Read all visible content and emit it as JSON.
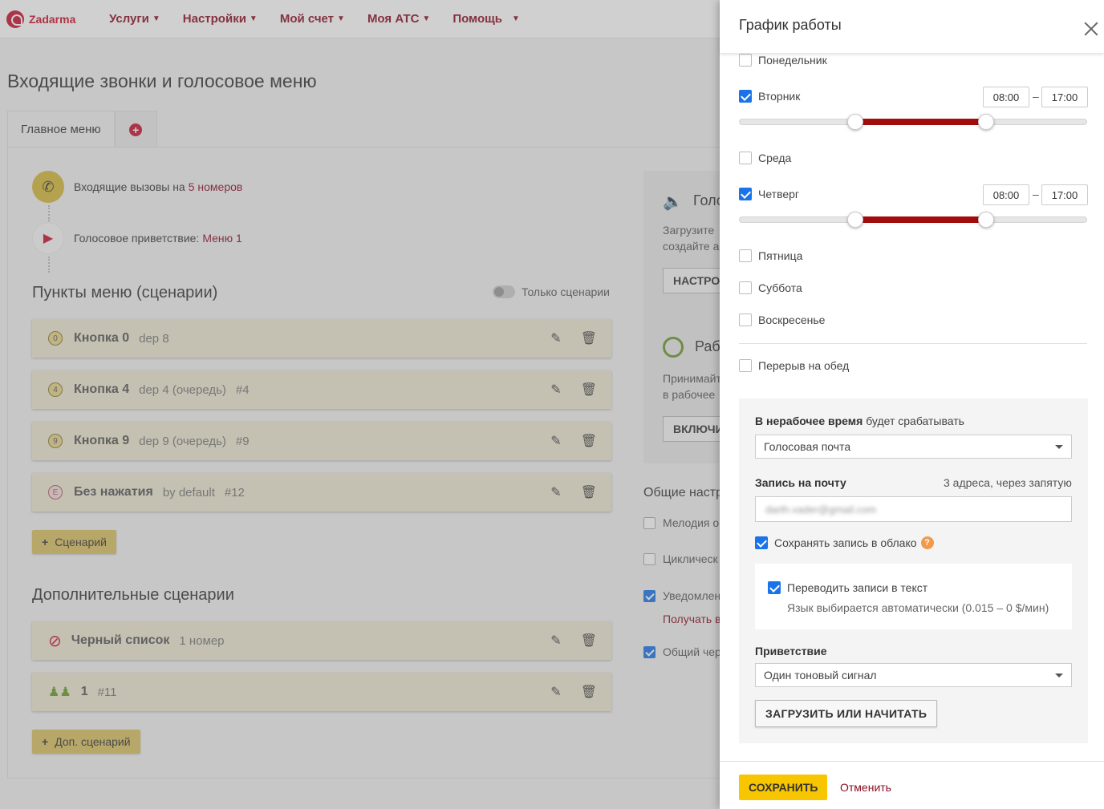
{
  "app": {
    "logo_text": "Zadarma"
  },
  "nav": {
    "items": [
      {
        "label": "Услуги"
      },
      {
        "label": "Настройки"
      },
      {
        "label": "Мой счет"
      },
      {
        "label": "Моя АТС"
      },
      {
        "label": "Помощь"
      }
    ]
  },
  "page": {
    "title": "Входящие звонки и голосовое меню",
    "tabs": [
      {
        "label": "Главное меню"
      },
      {
        "label": "+"
      }
    ]
  },
  "flow": {
    "incoming_prefix": "Входящие вызовы на",
    "incoming_link": "5 номеров",
    "greeting_prefix": "Голосовое приветствие:",
    "greeting_link": "Меню 1"
  },
  "menu_section": {
    "title": "Пункты меню (сценарии)",
    "toggle_label": "Только сценарии",
    "items": [
      {
        "key": "0",
        "name": "Кнопка 0",
        "sub": "dep 8",
        "extra": ""
      },
      {
        "key": "4",
        "name": "Кнопка 4",
        "sub": "dep 4 (очередь)",
        "extra": "#4"
      },
      {
        "key": "9",
        "name": "Кнопка 9",
        "sub": "dep 9 (очередь)",
        "extra": "#9"
      },
      {
        "key": "E",
        "name": "Без нажатия",
        "sub": "by default",
        "extra": "#12"
      }
    ],
    "add_button": "Сценарий"
  },
  "extra_section": {
    "title": "Дополнительные сценарии",
    "items": [
      {
        "name": "Черный список",
        "sub": "1 номер"
      },
      {
        "name": "1",
        "sub": "#11"
      }
    ],
    "add_button": "Доп. сценарий"
  },
  "right_column": {
    "voice_title": "Голо",
    "voice_text_1": "Загрузите",
    "voice_text_2": "создайте а",
    "voice_button": "НАСТРО",
    "work_title": "Раб",
    "work_text_1": "Принимайт",
    "work_text_2": "в рабочее",
    "work_button": "ВКЛЮЧИ",
    "general_title": "Общие настр",
    "opts": [
      {
        "label": "Мелодия о",
        "checked": false
      },
      {
        "label": "Циклическ",
        "checked": false
      },
      {
        "label": "Уведомлен",
        "checked": true
      },
      {
        "label": "Общий чер",
        "checked": true
      }
    ],
    "notify_link": "Получать в"
  },
  "drawer": {
    "title": "График работы",
    "days": [
      {
        "label": "Понедельник",
        "checked": false
      },
      {
        "label": "Вторник",
        "checked": true,
        "from": "08:00",
        "to": "17:00"
      },
      {
        "label": "Среда",
        "checked": false
      },
      {
        "label": "Четверг",
        "checked": true,
        "from": "08:00",
        "to": "17:00"
      },
      {
        "label": "Пятница",
        "checked": false
      },
      {
        "label": "Суббота",
        "checked": false
      },
      {
        "label": "Воскресенье",
        "checked": false
      }
    ],
    "time_separator": "–",
    "lunch": "Перерыв на обед",
    "offhours": {
      "label_bold": "В нерабочее время",
      "label_rest": "будет срабатывать",
      "select_value": "Голосовая почта",
      "email_label": "Запись на почту",
      "email_hint": "3 адреса, через запятую",
      "email_value": "darth.vader@gmail.com",
      "cloud_label": "Сохранять запись в облако",
      "help_glyph": "?",
      "transcribe_label": "Переводить записи в текст",
      "transcribe_hint": "Язык выбирается автоматически (0.015 – 0 $/мин)",
      "greeting_label": "Приветствие",
      "greeting_value": "Один тоновый сигнал",
      "upload_button": "ЗАГРУЗИТЬ ИЛИ НАЧИТАТЬ"
    },
    "save_button": "СОХРАНИТЬ",
    "cancel_button": "Отменить"
  },
  "colors": {
    "brand": "#c8102e",
    "accent_yellow": "#f7c600",
    "checkbox_blue": "#1a73e8",
    "slider_red": "#a10d0d"
  }
}
